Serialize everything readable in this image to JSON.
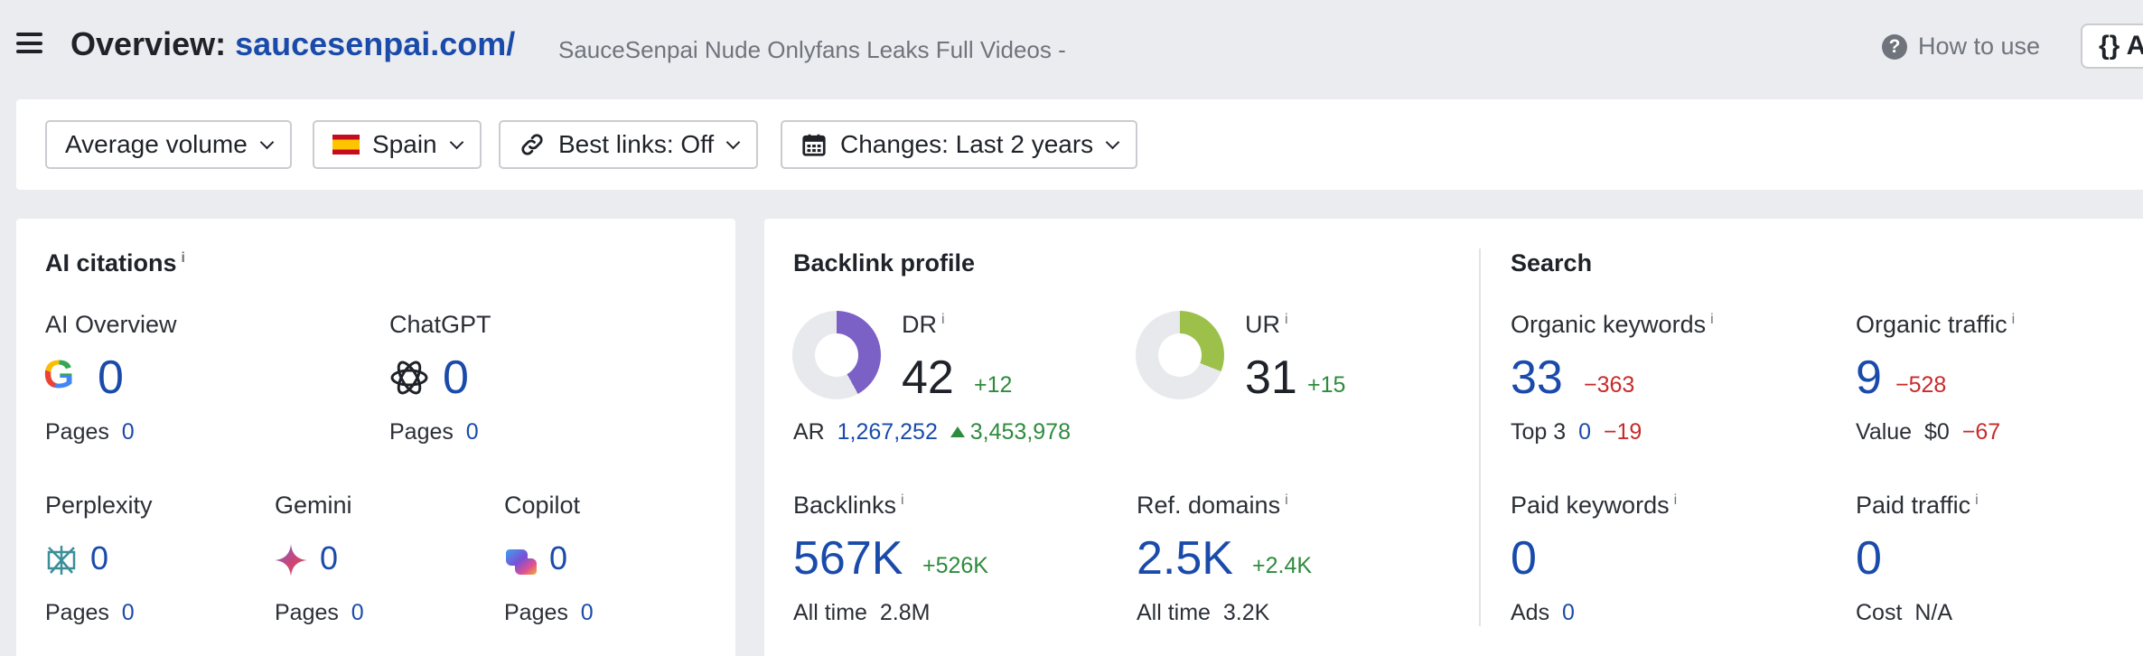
{
  "header": {
    "title_prefix": "Overview:",
    "domain": "saucesenpai.com/",
    "subtitle": "SauceSenpai Nude Onlyfans Leaks Full Videos -",
    "how_to_use": "How to use",
    "api_label": "{} A"
  },
  "filters": {
    "volume": "Average volume",
    "country": "Spain",
    "best_links": "Best links: Off",
    "changes": "Changes: Last 2 years"
  },
  "ai_citations": {
    "title": "AI citations",
    "info": "i",
    "pages_label": "Pages",
    "items": [
      {
        "name": "AI Overview",
        "value": "0",
        "pages": "0",
        "icon": "google-icon"
      },
      {
        "name": "ChatGPT",
        "value": "0",
        "pages": "0",
        "icon": "chatgpt-icon"
      },
      {
        "name": "Perplexity",
        "value": "0",
        "pages": "0",
        "icon": "perplexity-icon"
      },
      {
        "name": "Gemini",
        "value": "0",
        "pages": "0",
        "icon": "gemini-icon"
      },
      {
        "name": "Copilot",
        "value": "0",
        "pages": "0",
        "icon": "copilot-icon"
      }
    ]
  },
  "backlink_profile": {
    "title": "Backlink profile",
    "dr": {
      "label": "DR",
      "value": "42",
      "delta": "+12",
      "ring_fraction": 0.42
    },
    "ur": {
      "label": "UR",
      "value": "31",
      "delta": "+15",
      "ring_fraction": 0.31
    },
    "ar": {
      "label": "AR",
      "value": "1,267,252",
      "delta": "3,453,978"
    },
    "backlinks": {
      "label": "Backlinks",
      "value": "567K",
      "delta": "+526K",
      "alltime_label": "All time",
      "alltime": "2.8M"
    },
    "ref_domains": {
      "label": "Ref. domains",
      "value": "2.5K",
      "delta": "+2.4K",
      "alltime_label": "All time",
      "alltime": "3.2K"
    }
  },
  "search": {
    "title": "Search",
    "organic_keywords": {
      "label": "Organic keywords",
      "value": "33",
      "delta": "−363",
      "sub_label": "Top 3",
      "sub_value": "0",
      "sub_delta": "−19"
    },
    "organic_traffic": {
      "label": "Organic traffic",
      "value": "9",
      "delta": "−528",
      "sub_label": "Value",
      "sub_value": "$0",
      "sub_delta": "−67"
    },
    "paid_keywords": {
      "label": "Paid keywords",
      "value": "0",
      "sub_label": "Ads",
      "sub_value": "0"
    },
    "paid_traffic": {
      "label": "Paid traffic",
      "value": "0",
      "sub_label": "Cost",
      "sub_value": "N/A"
    }
  },
  "colors": {
    "accent_blue": "#1a4bab",
    "positive": "#2e8b3e",
    "negative": "#c72b2b",
    "dr_ring": "#7b61c6",
    "ur_ring": "#9cc04a"
  }
}
